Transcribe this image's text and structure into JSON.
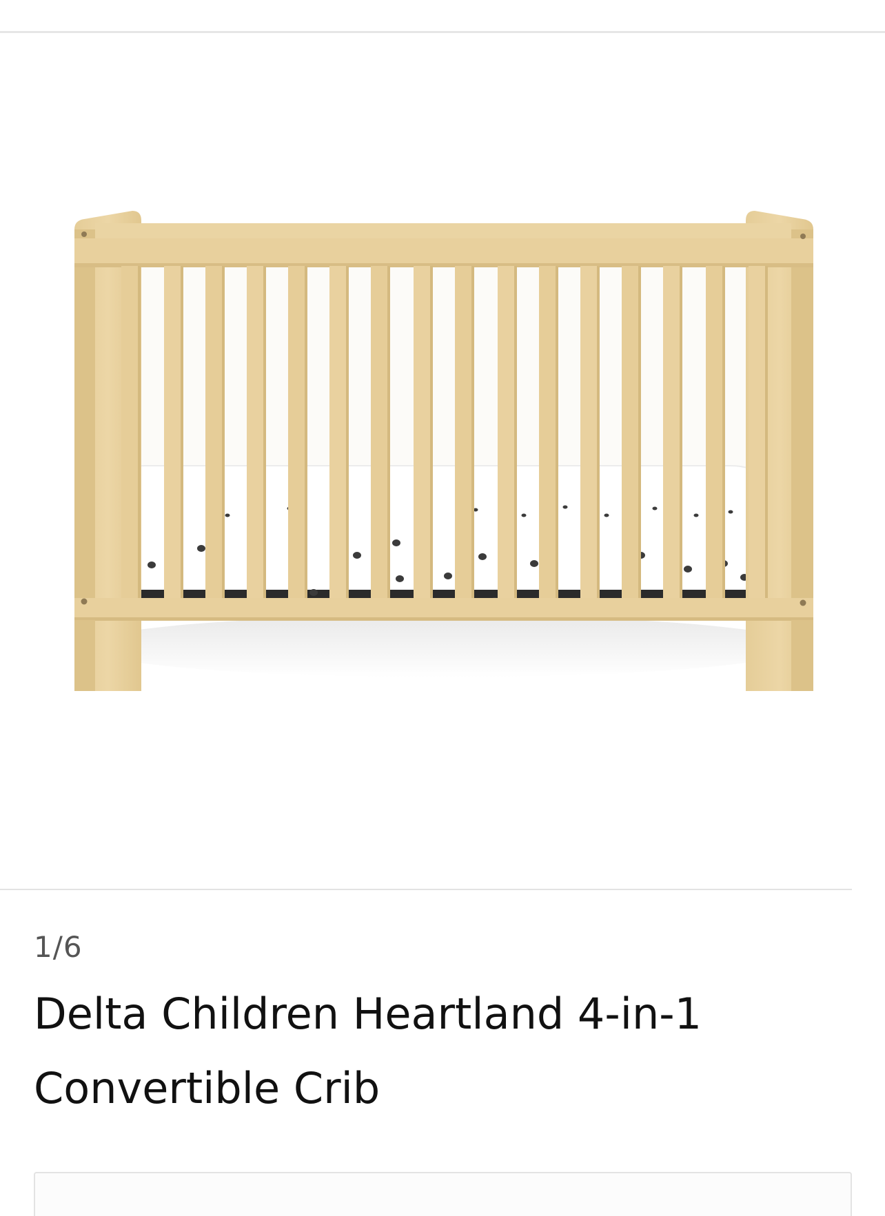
{
  "gallery": {
    "counter": "1/6",
    "image_alt": "crib-product-image"
  },
  "product": {
    "title": "Delta Children Heartland 4-in-1 Convertible Crib"
  },
  "colors": {
    "wood": "#e8d09d",
    "wood_shadow": "#d3b77e",
    "mattress": "#ffffff",
    "dots": "#3b3b3b",
    "divider": "#e3e3e3"
  }
}
